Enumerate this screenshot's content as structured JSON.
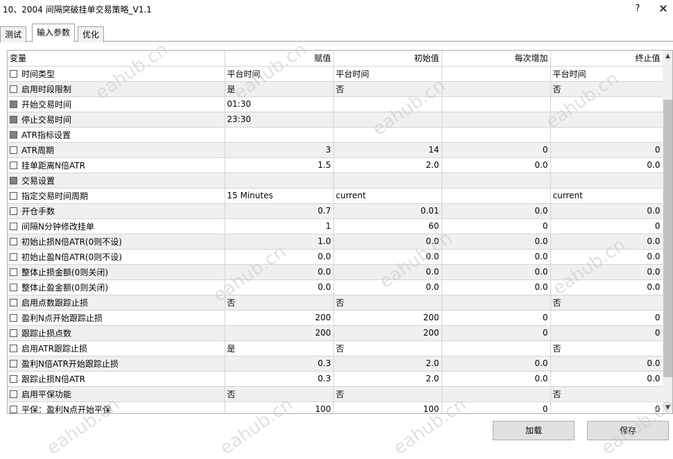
{
  "window": {
    "title": "10、2004 间隔突破挂单交易策略_V1.1",
    "help": "?",
    "close": "✕"
  },
  "tabs": [
    "测试",
    "输入参数",
    "优化"
  ],
  "active_tab": 1,
  "columns": {
    "name": "变量",
    "value": "赋值",
    "start": "初始值",
    "step": "每次增加",
    "stop": "终止值"
  },
  "rows": [
    {
      "name": "时间类型",
      "value": "平台时间",
      "start": "平台时间",
      "step": "",
      "stop": "平台时间",
      "align": "l",
      "group": false
    },
    {
      "name": "启用时段限制",
      "value": "是",
      "start": "否",
      "step": "",
      "stop": "否",
      "align": "l",
      "group": false
    },
    {
      "name": "开始交易时间",
      "value": "01:30",
      "start": "",
      "step": "",
      "stop": "",
      "align": "l",
      "group": true
    },
    {
      "name": "停止交易时间",
      "value": "23:30",
      "start": "",
      "step": "",
      "stop": "",
      "align": "l",
      "group": true
    },
    {
      "name": "ATR指标设置",
      "value": "",
      "start": "",
      "step": "",
      "stop": "",
      "align": "l",
      "group": true
    },
    {
      "name": "ATR周期",
      "value": "3",
      "start": "14",
      "step": "0",
      "stop": "0",
      "align": "r",
      "group": false
    },
    {
      "name": "挂单距离N倍ATR",
      "value": "1.5",
      "start": "2.0",
      "step": "0.0",
      "stop": "0.0",
      "align": "r",
      "group": false
    },
    {
      "name": "交易设置",
      "value": "",
      "start": "",
      "step": "",
      "stop": "",
      "align": "l",
      "group": true
    },
    {
      "name": "指定交易时间周期",
      "value": "15 Minutes",
      "start": "current",
      "step": "",
      "stop": "current",
      "align": "l",
      "group": false
    },
    {
      "name": "开仓手数",
      "value": "0.7",
      "start": "0.01",
      "step": "0.0",
      "stop": "0.0",
      "align": "r",
      "group": false
    },
    {
      "name": "间隔N分钟修改挂单",
      "value": "1",
      "start": "60",
      "step": "0",
      "stop": "0",
      "align": "r",
      "group": false
    },
    {
      "name": "初始止损N倍ATR(0则不设)",
      "value": "1.0",
      "start": "0.0",
      "step": "0.0",
      "stop": "0.0",
      "align": "r",
      "group": false
    },
    {
      "name": "初始止盈N倍ATR(0则不设)",
      "value": "0.0",
      "start": "0.0",
      "step": "0.0",
      "stop": "0.0",
      "align": "r",
      "group": false
    },
    {
      "name": "整体止损金额(0则关闭)",
      "value": "0.0",
      "start": "0.0",
      "step": "0.0",
      "stop": "0.0",
      "align": "r",
      "group": false
    },
    {
      "name": "整体止盈金额(0则关闭)",
      "value": "0.0",
      "start": "0.0",
      "step": "0.0",
      "stop": "0.0",
      "align": "r",
      "group": false
    },
    {
      "name": "启用点数跟踪止损",
      "value": "否",
      "start": "否",
      "step": "",
      "stop": "否",
      "align": "l",
      "group": false
    },
    {
      "name": "盈利N点开始跟踪止损",
      "value": "200",
      "start": "200",
      "step": "0",
      "stop": "0",
      "align": "r",
      "group": false
    },
    {
      "name": "跟踪止损点数",
      "value": "200",
      "start": "200",
      "step": "0",
      "stop": "0",
      "align": "r",
      "group": false
    },
    {
      "name": "启用ATR跟踪止损",
      "value": "是",
      "start": "否",
      "step": "",
      "stop": "否",
      "align": "l",
      "group": false
    },
    {
      "name": "盈利N倍ATR开始跟踪止损",
      "value": "0.3",
      "start": "2.0",
      "step": "0.0",
      "stop": "0.0",
      "align": "r",
      "group": false
    },
    {
      "name": "跟踪止损N倍ATR",
      "value": "0.3",
      "start": "2.0",
      "step": "0.0",
      "stop": "0.0",
      "align": "r",
      "group": false
    },
    {
      "name": "启用平保功能",
      "value": "否",
      "start": "否",
      "step": "",
      "stop": "否",
      "align": "l",
      "group": false
    },
    {
      "name": "平保：盈利N点开始平保",
      "value": "100",
      "start": "100",
      "step": "0",
      "stop": "0",
      "align": "r",
      "group": false
    }
  ],
  "buttons": {
    "load": "加载",
    "save": "保存"
  },
  "watermark": "eahub.cn"
}
